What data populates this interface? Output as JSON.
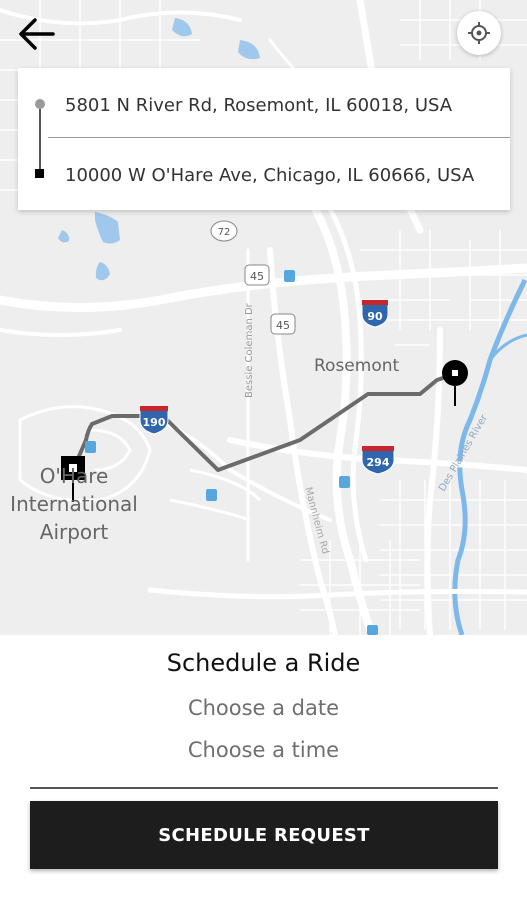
{
  "header": {
    "back_icon": "arrow-left-icon",
    "locate_icon": "crosshair-icon"
  },
  "route": {
    "pickup": "5801 N River Rd, Rosemont, IL 60018, USA",
    "dropoff": "10000 W O'Hare Ave, Chicago, IL 60666, USA"
  },
  "map": {
    "labels": {
      "rosemont": "Rosemont",
      "ohare": "O'Hare International Airport",
      "bessie_coleman": "Bessie Coleman Dr",
      "des_plaines": "Des Plaines River",
      "mannheim": "Mannheim Rd"
    },
    "shields": {
      "i190": "190",
      "i90": "90",
      "i294": "294",
      "us45a": "45",
      "us45b": "45",
      "r72": "72"
    },
    "colors": {
      "land": "#eeeeee",
      "water": "#9fc8ec",
      "road": "#ffffff",
      "route": "#6b6b6b",
      "transit": "#56a7e0",
      "interstate_red": "#c9252c",
      "interstate_blue": "#2f66ae"
    }
  },
  "schedule": {
    "title": "Schedule a Ride",
    "date_placeholder": "Choose a date",
    "time_placeholder": "Choose a time",
    "submit_label": "SCHEDULE REQUEST"
  }
}
